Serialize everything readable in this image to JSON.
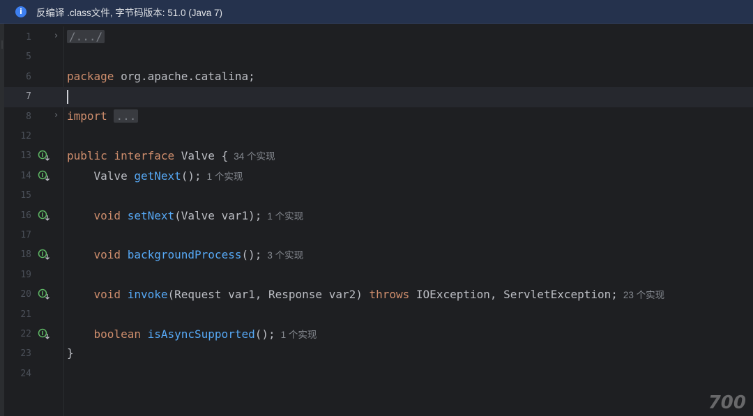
{
  "banner": {
    "icon": "info-icon",
    "text": "反编译 .class文件, 字节码版本: 51.0 (Java 7)"
  },
  "editor": {
    "lines": [
      {
        "num": "1"
      },
      {
        "num": "5"
      },
      {
        "num": "6"
      },
      {
        "num": "7"
      },
      {
        "num": "8"
      },
      {
        "num": "12"
      },
      {
        "num": "13"
      },
      {
        "num": "14"
      },
      {
        "num": "15"
      },
      {
        "num": "16"
      },
      {
        "num": "17"
      },
      {
        "num": "18"
      },
      {
        "num": "19"
      },
      {
        "num": "20"
      },
      {
        "num": "21"
      },
      {
        "num": "22"
      },
      {
        "num": "23"
      },
      {
        "num": "24"
      }
    ],
    "code": {
      "l1_fold": "/.../",
      "l6_kw": "package",
      "l6_rest": " org.apache.catalina;",
      "l8_kw": "import",
      "l8_fold": "...",
      "l13_kw1": "public",
      "l13_kw2": "interface",
      "l13_rest": " Valve {",
      "l13_hint": "34 个实现",
      "l14_type": "    Valve ",
      "l14_fn": "getNext",
      "l14_rest": "();",
      "l14_hint": "1 个实现",
      "l16_kw": "    void ",
      "l16_fn": "setNext",
      "l16_rest": "(Valve var1);",
      "l16_hint": "1 个实现",
      "l18_kw": "    void ",
      "l18_fn": "backgroundProcess",
      "l18_rest": "();",
      "l18_hint": "3 个实现",
      "l20_kw": "    void ",
      "l20_fn": "invoke",
      "l20_rest1": "(Request var1, Response var2) ",
      "l20_throws": "throws",
      "l20_rest2": " IOException, ServletException;",
      "l20_hint": "23 个实现",
      "l22_kw": "    boolean ",
      "l22_fn": "isAsyncSupported",
      "l22_rest": "();",
      "l22_hint": "1 个实现",
      "l23_brace": "}"
    }
  },
  "watermark": {
    "text": "700"
  },
  "colors": {
    "background": "#1e1f22",
    "keyword": "#cf8e6d",
    "function": "#56a8f5",
    "text": "#bcbec4",
    "banner": "#25324d",
    "implemented_icon": "#5fb865"
  }
}
